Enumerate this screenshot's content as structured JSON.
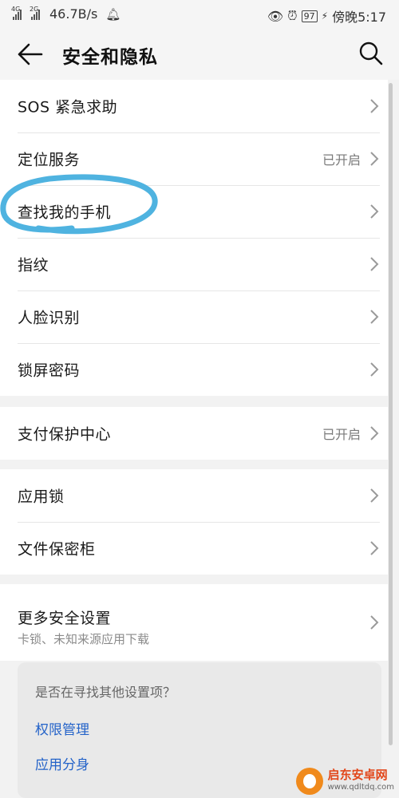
{
  "status_bar": {
    "network1": "4G",
    "network2": "2G",
    "speed": "46.7B/s",
    "battery": "97",
    "time": "傍晚5:17"
  },
  "header": {
    "title": "安全和隐私"
  },
  "sections": [
    {
      "rows": [
        {
          "label": "SOS 紧急求助",
          "status": ""
        },
        {
          "label": "定位服务",
          "status": "已开启"
        },
        {
          "label": "查找我的手机",
          "status": ""
        },
        {
          "label": "指纹",
          "status": ""
        },
        {
          "label": "人脸识别",
          "status": ""
        },
        {
          "label": "锁屏密码",
          "status": ""
        }
      ]
    },
    {
      "rows": [
        {
          "label": "支付保护中心",
          "status": "已开启"
        }
      ]
    },
    {
      "rows": [
        {
          "label": "应用锁",
          "status": ""
        },
        {
          "label": "文件保密柜",
          "status": ""
        }
      ]
    },
    {
      "rows": [
        {
          "label": "更多安全设置",
          "sub": "卡锁、未知来源应用下载"
        }
      ]
    }
  ],
  "hint": {
    "question": "是否在寻找其他设置项？",
    "links": [
      "权限管理",
      "应用分身"
    ]
  },
  "watermark": {
    "title": "启东安卓网",
    "url": "www.qdltdq.com"
  },
  "colors": {
    "link": "#2463c9",
    "annotation": "#4fb3e0"
  }
}
